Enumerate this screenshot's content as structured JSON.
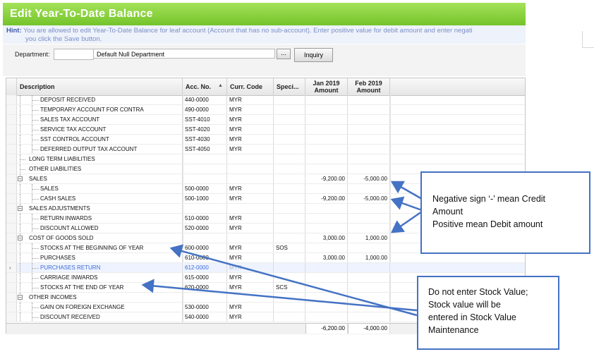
{
  "window": {
    "title": "Edit Year-To-Date Balance"
  },
  "hint": {
    "label": "Hint:",
    "line1": "You are allowed to edit Year-To-Date Balance for leaf account (Account that has no sub-account). Enter positive value for debit amount and enter negati",
    "line2": "you click the Save button."
  },
  "department": {
    "label": "Department:",
    "code": "",
    "name": "Default Null Department",
    "browse_label": "...",
    "inquiry_label": "Inquiry"
  },
  "grid": {
    "columns": [
      {
        "key": "desc",
        "label": "Description"
      },
      {
        "key": "acc",
        "label": "Acc. No."
      },
      {
        "key": "cur",
        "label": "Curr. Code"
      },
      {
        "key": "spe",
        "label": "Speci..."
      },
      {
        "key": "jan",
        "label": "Jan 2019 Amount"
      },
      {
        "key": "feb",
        "label": "Feb 2019 Amount"
      }
    ],
    "sort_icon": "sort-ascending-icon",
    "rows": [
      {
        "level": 2,
        "desc": "DEPOSIT RECEIVED",
        "acc": "440-0000",
        "cur": "MYR",
        "spe": "",
        "jan": "",
        "feb": ""
      },
      {
        "level": 2,
        "desc": "TEMPORARY ACCOUNT FOR CONTRA",
        "acc": "490-0000",
        "cur": "MYR",
        "spe": "",
        "jan": "",
        "feb": ""
      },
      {
        "level": 2,
        "desc": "SALES TAX ACCOUNT",
        "acc": "SST-4010",
        "cur": "MYR",
        "spe": "",
        "jan": "",
        "feb": ""
      },
      {
        "level": 2,
        "desc": "SERVICE TAX ACCOUNT",
        "acc": "SST-4020",
        "cur": "MYR",
        "spe": "",
        "jan": "",
        "feb": ""
      },
      {
        "level": 2,
        "desc": "SST CONTROL ACCOUNT",
        "acc": "SST-4030",
        "cur": "MYR",
        "spe": "",
        "jan": "",
        "feb": ""
      },
      {
        "level": 2,
        "desc": "DEFERRED OUTPUT TAX ACCOUNT",
        "acc": "SST-4050",
        "cur": "MYR",
        "spe": "",
        "jan": "",
        "feb": ""
      },
      {
        "level": 1,
        "desc": "LONG TERM LIABILITIES",
        "acc": "",
        "cur": "",
        "spe": "",
        "jan": "",
        "feb": ""
      },
      {
        "level": 1,
        "desc": "OTHER LIABILITIES",
        "acc": "",
        "cur": "",
        "spe": "",
        "jan": "",
        "feb": ""
      },
      {
        "level": 1,
        "expander": "−",
        "desc": "SALES",
        "acc": "",
        "cur": "",
        "spe": "",
        "jan": "-9,200.00",
        "feb": "-5,000.00"
      },
      {
        "level": 2,
        "desc": "SALES",
        "acc": "500-0000",
        "cur": "MYR",
        "spe": "",
        "jan": "",
        "feb": ""
      },
      {
        "level": 2,
        "desc": "CASH SALES",
        "acc": "500-1000",
        "cur": "MYR",
        "spe": "",
        "jan": "-9,200.00",
        "feb": "-5,000.00"
      },
      {
        "level": 1,
        "expander": "−",
        "desc": "SALES ADJUSTMENTS",
        "acc": "",
        "cur": "",
        "spe": "",
        "jan": "",
        "feb": ""
      },
      {
        "level": 2,
        "desc": "RETURN INWARDS",
        "acc": "510-0000",
        "cur": "MYR",
        "spe": "",
        "jan": "",
        "feb": ""
      },
      {
        "level": 2,
        "desc": "DISCOUNT ALLOWED",
        "acc": "520-0000",
        "cur": "MYR",
        "spe": "",
        "jan": "",
        "feb": ""
      },
      {
        "level": 1,
        "expander": "−",
        "desc": "COST OF GOODS SOLD",
        "acc": "",
        "cur": "",
        "spe": "",
        "jan": "3,000.00",
        "feb": "1,000.00"
      },
      {
        "level": 2,
        "desc": "STOCKS AT THE BEGINNING OF YEAR",
        "acc": "600-0000",
        "cur": "MYR",
        "spe": "SOS",
        "jan": "",
        "feb": ""
      },
      {
        "level": 2,
        "desc": "PURCHASES",
        "acc": "610-0000",
        "cur": "MYR",
        "spe": "",
        "jan": "3,000.00",
        "feb": "1,000.00"
      },
      {
        "level": 2,
        "desc": "PURCHASES RETURN",
        "acc": "612-0000",
        "cur": "MYR",
        "spe": "",
        "jan": "",
        "feb": "",
        "selected": true
      },
      {
        "level": 2,
        "desc": "CARRIAGE INWARDS",
        "acc": "615-0000",
        "cur": "MYR",
        "spe": "",
        "jan": "",
        "feb": ""
      },
      {
        "level": 2,
        "desc": "STOCKS AT THE END OF YEAR",
        "acc": "620-0000",
        "cur": "MYR",
        "spe": "SCS",
        "jan": "",
        "feb": ""
      },
      {
        "level": 1,
        "expander": "−",
        "desc": "OTHER INCOMES",
        "acc": "",
        "cur": "",
        "spe": "",
        "jan": "",
        "feb": ""
      },
      {
        "level": 2,
        "desc": "GAIN ON FOREIGN EXCHANGE",
        "acc": "530-0000",
        "cur": "MYR",
        "spe": "",
        "jan": "",
        "feb": ""
      },
      {
        "level": 2,
        "desc": "DISCOUNT RECEIVED",
        "acc": "540-0000",
        "cur": "MYR",
        "spe": "",
        "jan": "",
        "feb": ""
      }
    ],
    "selected_row_marker": "›",
    "totals": {
      "jan": "-6,200.00",
      "feb": "-4,000.00"
    }
  },
  "callouts": {
    "credit_debit": [
      "Negative sign ‘-’ mean Credit",
      "Amount",
      "Positive mean Debit amount"
    ],
    "stock": [
      "Do not enter Stock Value;",
      "Stock value will be",
      "entered in Stock Value",
      "Maintenance"
    ]
  },
  "colors": {
    "title_bar": "#8fd443",
    "callout_border": "#4472c4",
    "selected_text": "#3a6bd8"
  }
}
